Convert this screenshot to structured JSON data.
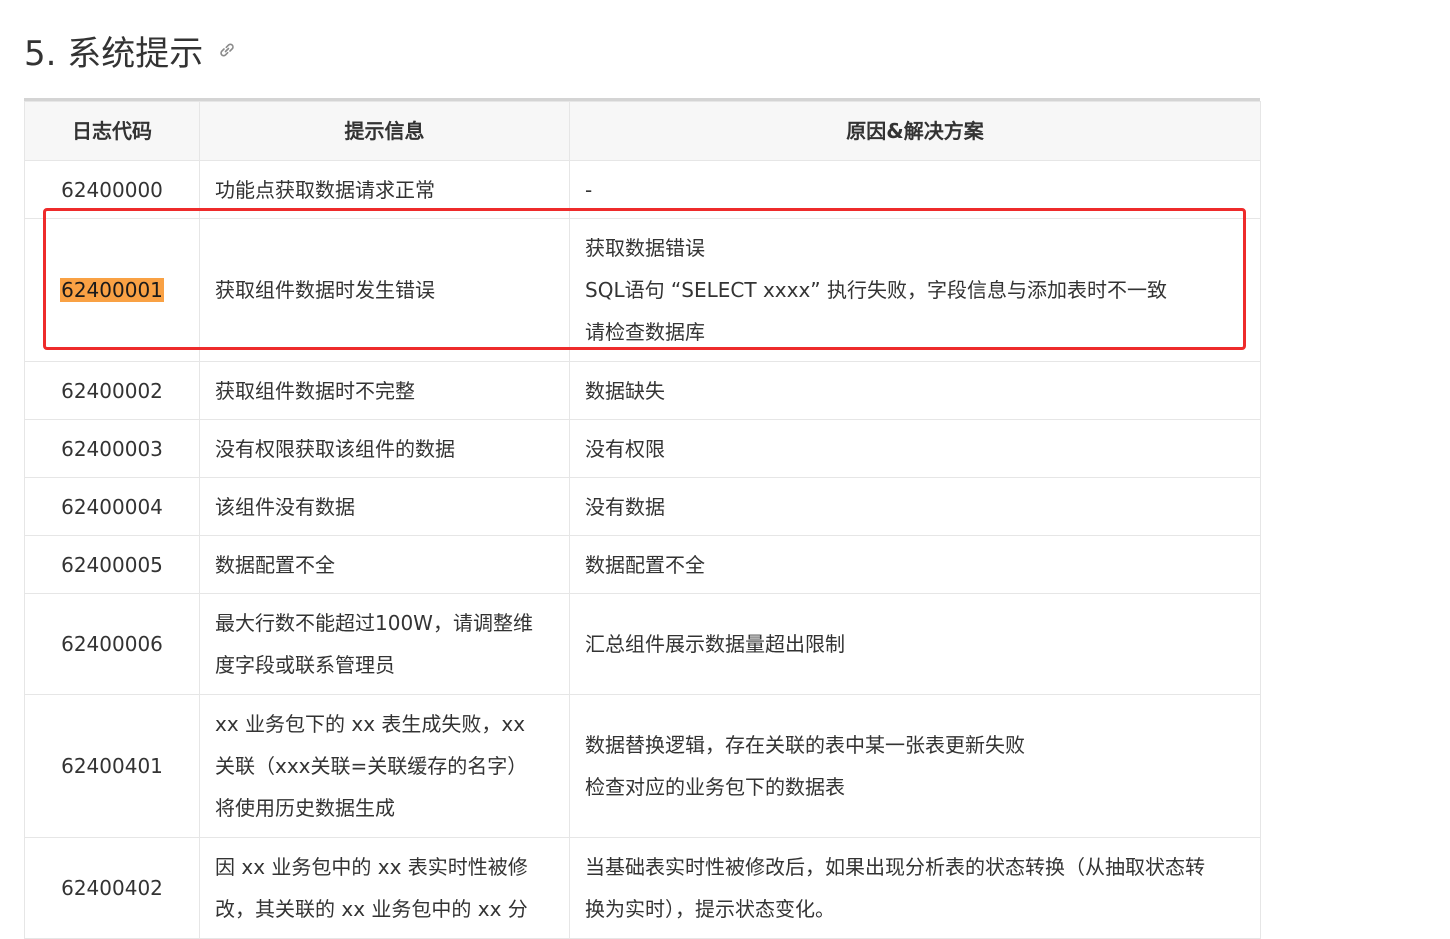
{
  "heading": {
    "title": "5. 系统提示",
    "link_icon": "link-icon"
  },
  "table": {
    "headers": [
      "日志代码",
      "提示信息",
      "原因&解决方案"
    ],
    "rows": [
      {
        "code": "62400000",
        "message": [
          "功能点获取数据请求正常"
        ],
        "solution": [
          "-"
        ]
      },
      {
        "code": "62400001",
        "message": [
          "获取组件数据时发生错误"
        ],
        "solution": [
          "获取数据错误",
          "SQL语句 “SELECT xxxx” 执行失败，字段信息与添加表时不一致",
          "请检查数据库"
        ]
      },
      {
        "code": "62400002",
        "message": [
          "获取组件数据时不完整"
        ],
        "solution": [
          "数据缺失"
        ]
      },
      {
        "code": "62400003",
        "message": [
          "没有权限获取该组件的数据"
        ],
        "solution": [
          "没有权限"
        ]
      },
      {
        "code": "62400004",
        "message": [
          "该组件没有数据"
        ],
        "solution": [
          "没有数据"
        ]
      },
      {
        "code": "62400005",
        "message": [
          "数据配置不全"
        ],
        "solution": [
          "数据配置不全"
        ]
      },
      {
        "code": "62400006",
        "message": [
          "最大行数不能超过100W，请调整维",
          "度字段或联系管理员"
        ],
        "solution": [
          "汇总组件展示数据量超出限制"
        ]
      },
      {
        "code": "62400401",
        "message": [
          "xx 业务包下的 xx 表生成失败，xx",
          "关联（xxx关联=关联缓存的名字）",
          "将使用历史数据生成"
        ],
        "solution": [
          "数据替换逻辑，存在关联的表中某一张表更新失败",
          "检查对应的业务包下的数据表"
        ]
      },
      {
        "code": "62400402",
        "message": [
          "因 xx 业务包中的 xx 表实时性被修",
          "改，其关联的 xx 业务包中的 xx 分"
        ],
        "solution": [
          "当基础表实时性被修改后，如果出现分析表的状态转换（从抽取状态转",
          "换为实时），提示状态变化。"
        ]
      }
    ]
  },
  "highlight_color": "#f9a144",
  "annotation_box_color": "#ee2b2b"
}
